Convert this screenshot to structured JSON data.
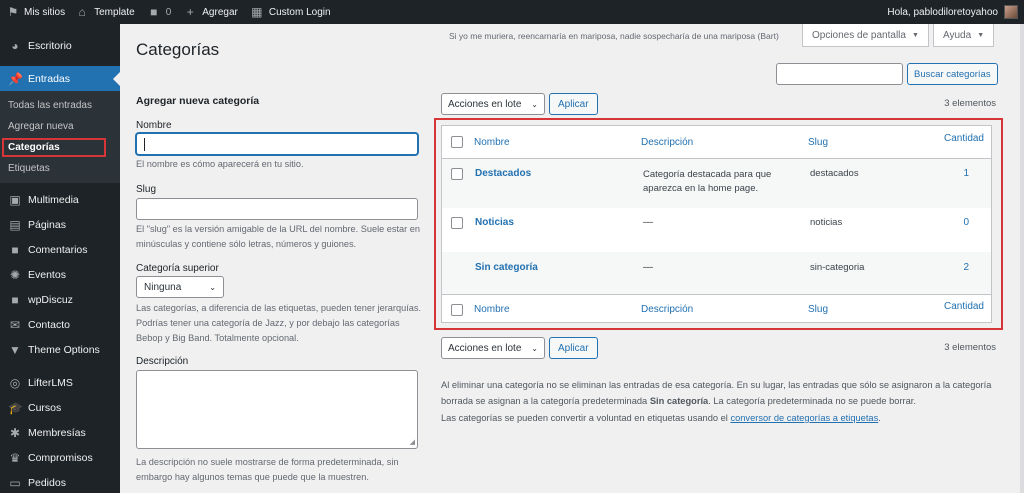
{
  "adminbar": {
    "sites_label": "Mis sitios",
    "site_name": "Template",
    "comments_count": "0",
    "new_label": "Agregar",
    "custom_login_label": "Custom Login",
    "greeting": "Hola, pablodiloretoyahoo"
  },
  "sidebar": {
    "dashboard": "Escritorio",
    "posts": "Entradas",
    "sub": {
      "all": "Todas las entradas",
      "add": "Agregar nueva",
      "categories": "Categorías",
      "tags": "Etiquetas"
    },
    "items": [
      {
        "label": "Multimedia",
        "icon": "media-icon",
        "glyph": "▣"
      },
      {
        "label": "Páginas",
        "icon": "pages-icon",
        "glyph": "▤"
      },
      {
        "label": "Comentarios",
        "icon": "comments-icon",
        "glyph": "■"
      },
      {
        "label": "Eventos",
        "icon": "events-icon",
        "glyph": "✺"
      },
      {
        "label": "wpDiscuz",
        "icon": "discuz-icon",
        "glyph": "■"
      },
      {
        "label": "Contacto",
        "icon": "mail-icon",
        "glyph": "✉"
      },
      {
        "label": "Theme Options",
        "icon": "triangle-icon",
        "glyph": "▼"
      },
      {
        "label": "LifterLMS",
        "icon": "lifterlms-icon",
        "glyph": "◎"
      },
      {
        "label": "Cursos",
        "icon": "courses-icon",
        "glyph": "🎓"
      },
      {
        "label": "Membresías",
        "icon": "memberships-icon",
        "glyph": "✱"
      },
      {
        "label": "Compromisos",
        "icon": "engagements-icon",
        "glyph": "♛"
      },
      {
        "label": "Pedidos",
        "icon": "orders-icon",
        "glyph": "▭"
      }
    ]
  },
  "header": {
    "title": "Categorías",
    "quote": "Si yo me muriera, reencarnaría en mariposa, nadie sospecharía de una mariposa (Bart)",
    "screen_options": "Opciones de pantalla",
    "help": "Ayuda"
  },
  "search": {
    "value": "",
    "button": "Buscar categorías"
  },
  "form": {
    "title": "Agregar nueva categoría",
    "name_label": "Nombre",
    "name_help": "El nombre es cómo aparecerá en tu sitio.",
    "slug_label": "Slug",
    "slug_help": "El \"slug\" es la versión amigable de la URL del nombre. Suele estar en minúsculas y contiene sólo letras, números y guiones.",
    "parent_label": "Categoría superior",
    "parent_value": "Ninguna",
    "parent_help": "Las categorías, a diferencia de las etiquetas, pueden tener jerarquías. Podrías tener una categoría de Jazz, y por debajo las categorías Bebop y Big Band. Totalmente opcional.",
    "desc_label": "Descripción",
    "desc_help": "La descripción no suele mostrarse de forma predeterminada, sin embargo hay algunos temas que puede que la muestren."
  },
  "bulk": {
    "action": "Acciones en lote",
    "apply": "Aplicar",
    "count": "3 elementos"
  },
  "table": {
    "headers": {
      "name": "Nombre",
      "description": "Descripción",
      "slug": "Slug",
      "count": "Cantidad"
    },
    "rows": [
      {
        "name": "Destacados",
        "description": "Categoría destacada para que aparezca en la home page.",
        "slug": "destacados",
        "count": "1"
      },
      {
        "name": "Noticias",
        "description": "—",
        "slug": "noticias",
        "count": "0"
      },
      {
        "name": "Sin categoría",
        "description": "—",
        "slug": "sin-categoria",
        "count": "2"
      }
    ]
  },
  "notes": {
    "line1_a": "Al eliminar una categoría no se eliminan las entradas de esa categoría. En su lugar, las entradas que sólo se asignaron a la categoría borrada se asignan a la categoría predeterminada ",
    "line1_b": "Sin categoría",
    "line1_c": ". La categoría predeterminada no se puede borrar.",
    "line2_a": "Las categorías se pueden convertir a voluntad en etiquetas usando el ",
    "line2_link": "conversor de categorías a etiquetas",
    "line2_c": "."
  }
}
